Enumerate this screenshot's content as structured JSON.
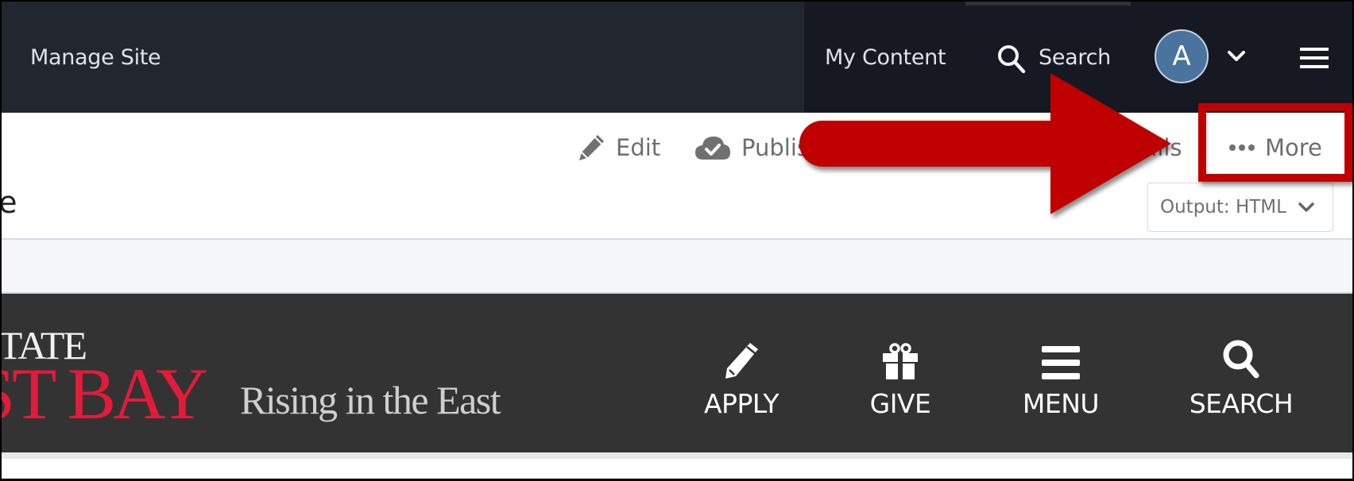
{
  "header": {
    "manage_site": "Manage Site",
    "my_content": "My Content",
    "search_label": "Search",
    "avatar_initial": "A",
    "avatar_color": "#4a739e"
  },
  "toolbar": {
    "edit_label": "Edit",
    "publish_label": "Publish",
    "details_label": "Details",
    "more_label": "More",
    "output_select": "Output: HTML"
  },
  "page": {
    "title_fragment": "ge"
  },
  "site_preview": {
    "logo_state": "STATE",
    "logo_bay": "ST BAY",
    "tagline": "Rising in the East",
    "brand_red": "#e31b3a",
    "nav": [
      {
        "label": "APPLY",
        "icon": "pencil-icon"
      },
      {
        "label": "GIVE",
        "icon": "gift-icon"
      },
      {
        "label": "MENU",
        "icon": "hamburger-icon"
      },
      {
        "label": "SEARCH",
        "icon": "search-icon"
      }
    ]
  },
  "annotation": {
    "color": "#c00000",
    "target": "More"
  }
}
